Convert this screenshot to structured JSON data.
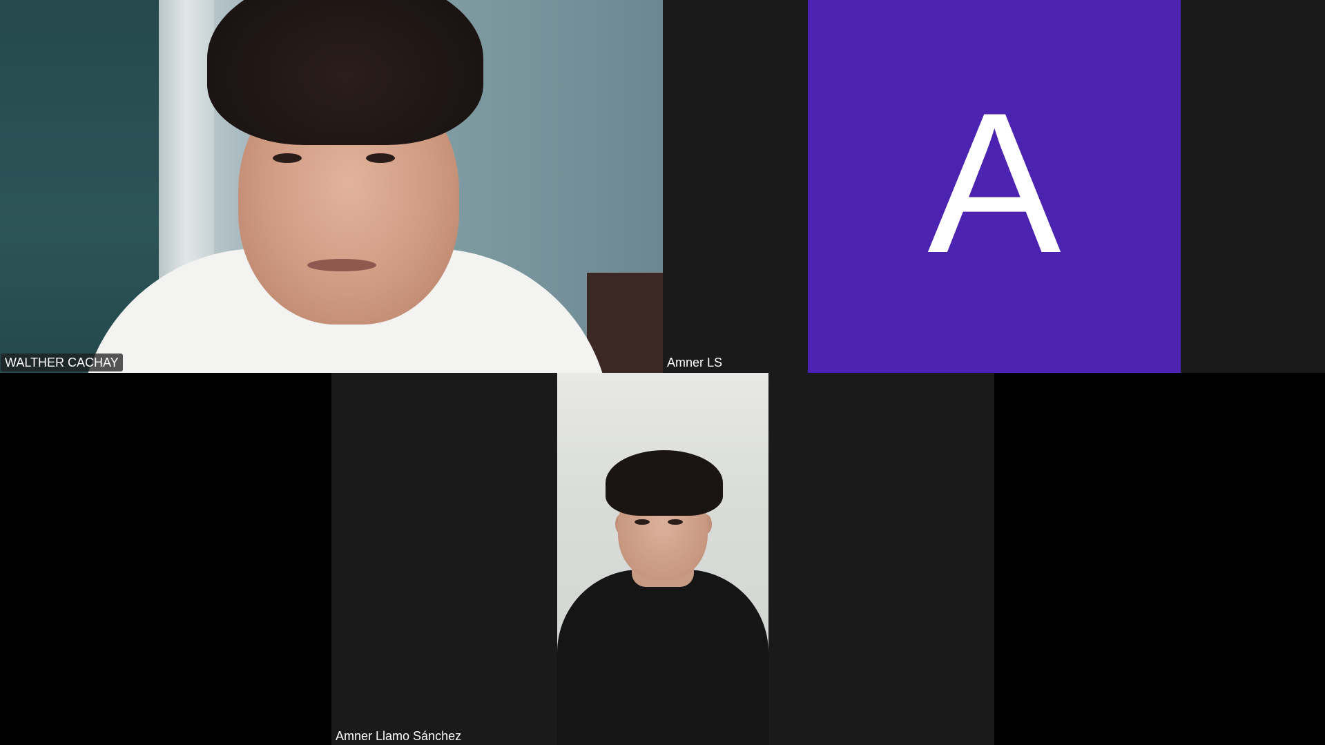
{
  "participants": [
    {
      "name": "WALTHER CACHAY",
      "type": "video"
    },
    {
      "name": "Amner LS",
      "type": "avatar",
      "avatar_letter": "A",
      "avatar_color": "#4c22b0"
    },
    {
      "name": "Amner Llamo Sánchez",
      "type": "video"
    }
  ],
  "colors": {
    "background": "#000000",
    "tile_background": "#1a1a1a",
    "label_text": "#ffffff"
  }
}
